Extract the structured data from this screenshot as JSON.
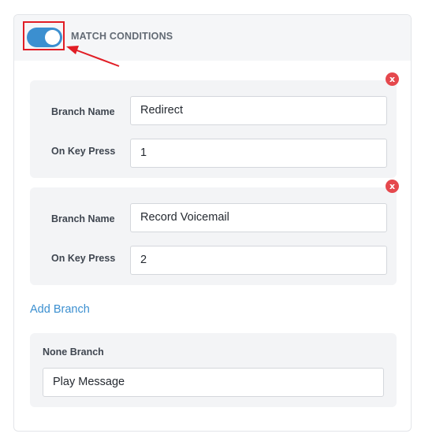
{
  "header": {
    "title": "MATCH CONDITIONS",
    "toggle_on": true
  },
  "branches": [
    {
      "name_label": "Branch Name",
      "name_value": "Redirect",
      "key_label": "On Key Press",
      "key_value": "1",
      "remove_glyph": "x"
    },
    {
      "name_label": "Branch Name",
      "name_value": "Record Voicemail",
      "key_label": "On Key Press",
      "key_value": "2",
      "remove_glyph": "x"
    }
  ],
  "add_branch_label": "Add Branch",
  "none_branch": {
    "label": "None Branch",
    "value": "Play Message"
  },
  "colors": {
    "accent": "#3b8fd0",
    "highlight": "#e11d25",
    "remove": "#e5484d"
  }
}
